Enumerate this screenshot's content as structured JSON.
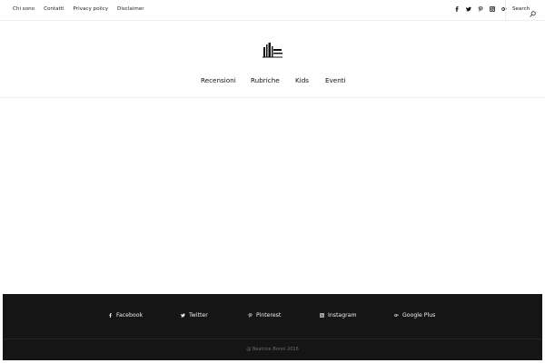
{
  "top_links": [
    "Chi sono",
    "Contatti",
    "Privacy policy",
    "Disclaimer"
  ],
  "top_socials": [
    {
      "icon": "facebook-icon"
    },
    {
      "icon": "twitter-icon"
    },
    {
      "icon": "pinterest-icon"
    },
    {
      "icon": "instagram-icon"
    },
    {
      "icon": "google-plus-icon"
    }
  ],
  "search": {
    "label": "Search"
  },
  "main_nav": [
    "Recensioni",
    "Rubriche",
    "Kids",
    "Eventi"
  ],
  "footer": {
    "socials": [
      {
        "label": "Facebook",
        "icon": "facebook-icon"
      },
      {
        "label": "Twitter",
        "icon": "twitter-icon"
      },
      {
        "label": "Pinterest",
        "icon": "pinterest-icon"
      },
      {
        "label": "Instagram",
        "icon": "instagram-icon"
      },
      {
        "label": "Google Plus",
        "icon": "google-plus-icon"
      }
    ],
    "copyright": "@ Beatrice Bonni 2016"
  },
  "colors": {
    "footer_bg": "#151515",
    "text": "#222222",
    "footer_text": "#f0f0f0"
  }
}
